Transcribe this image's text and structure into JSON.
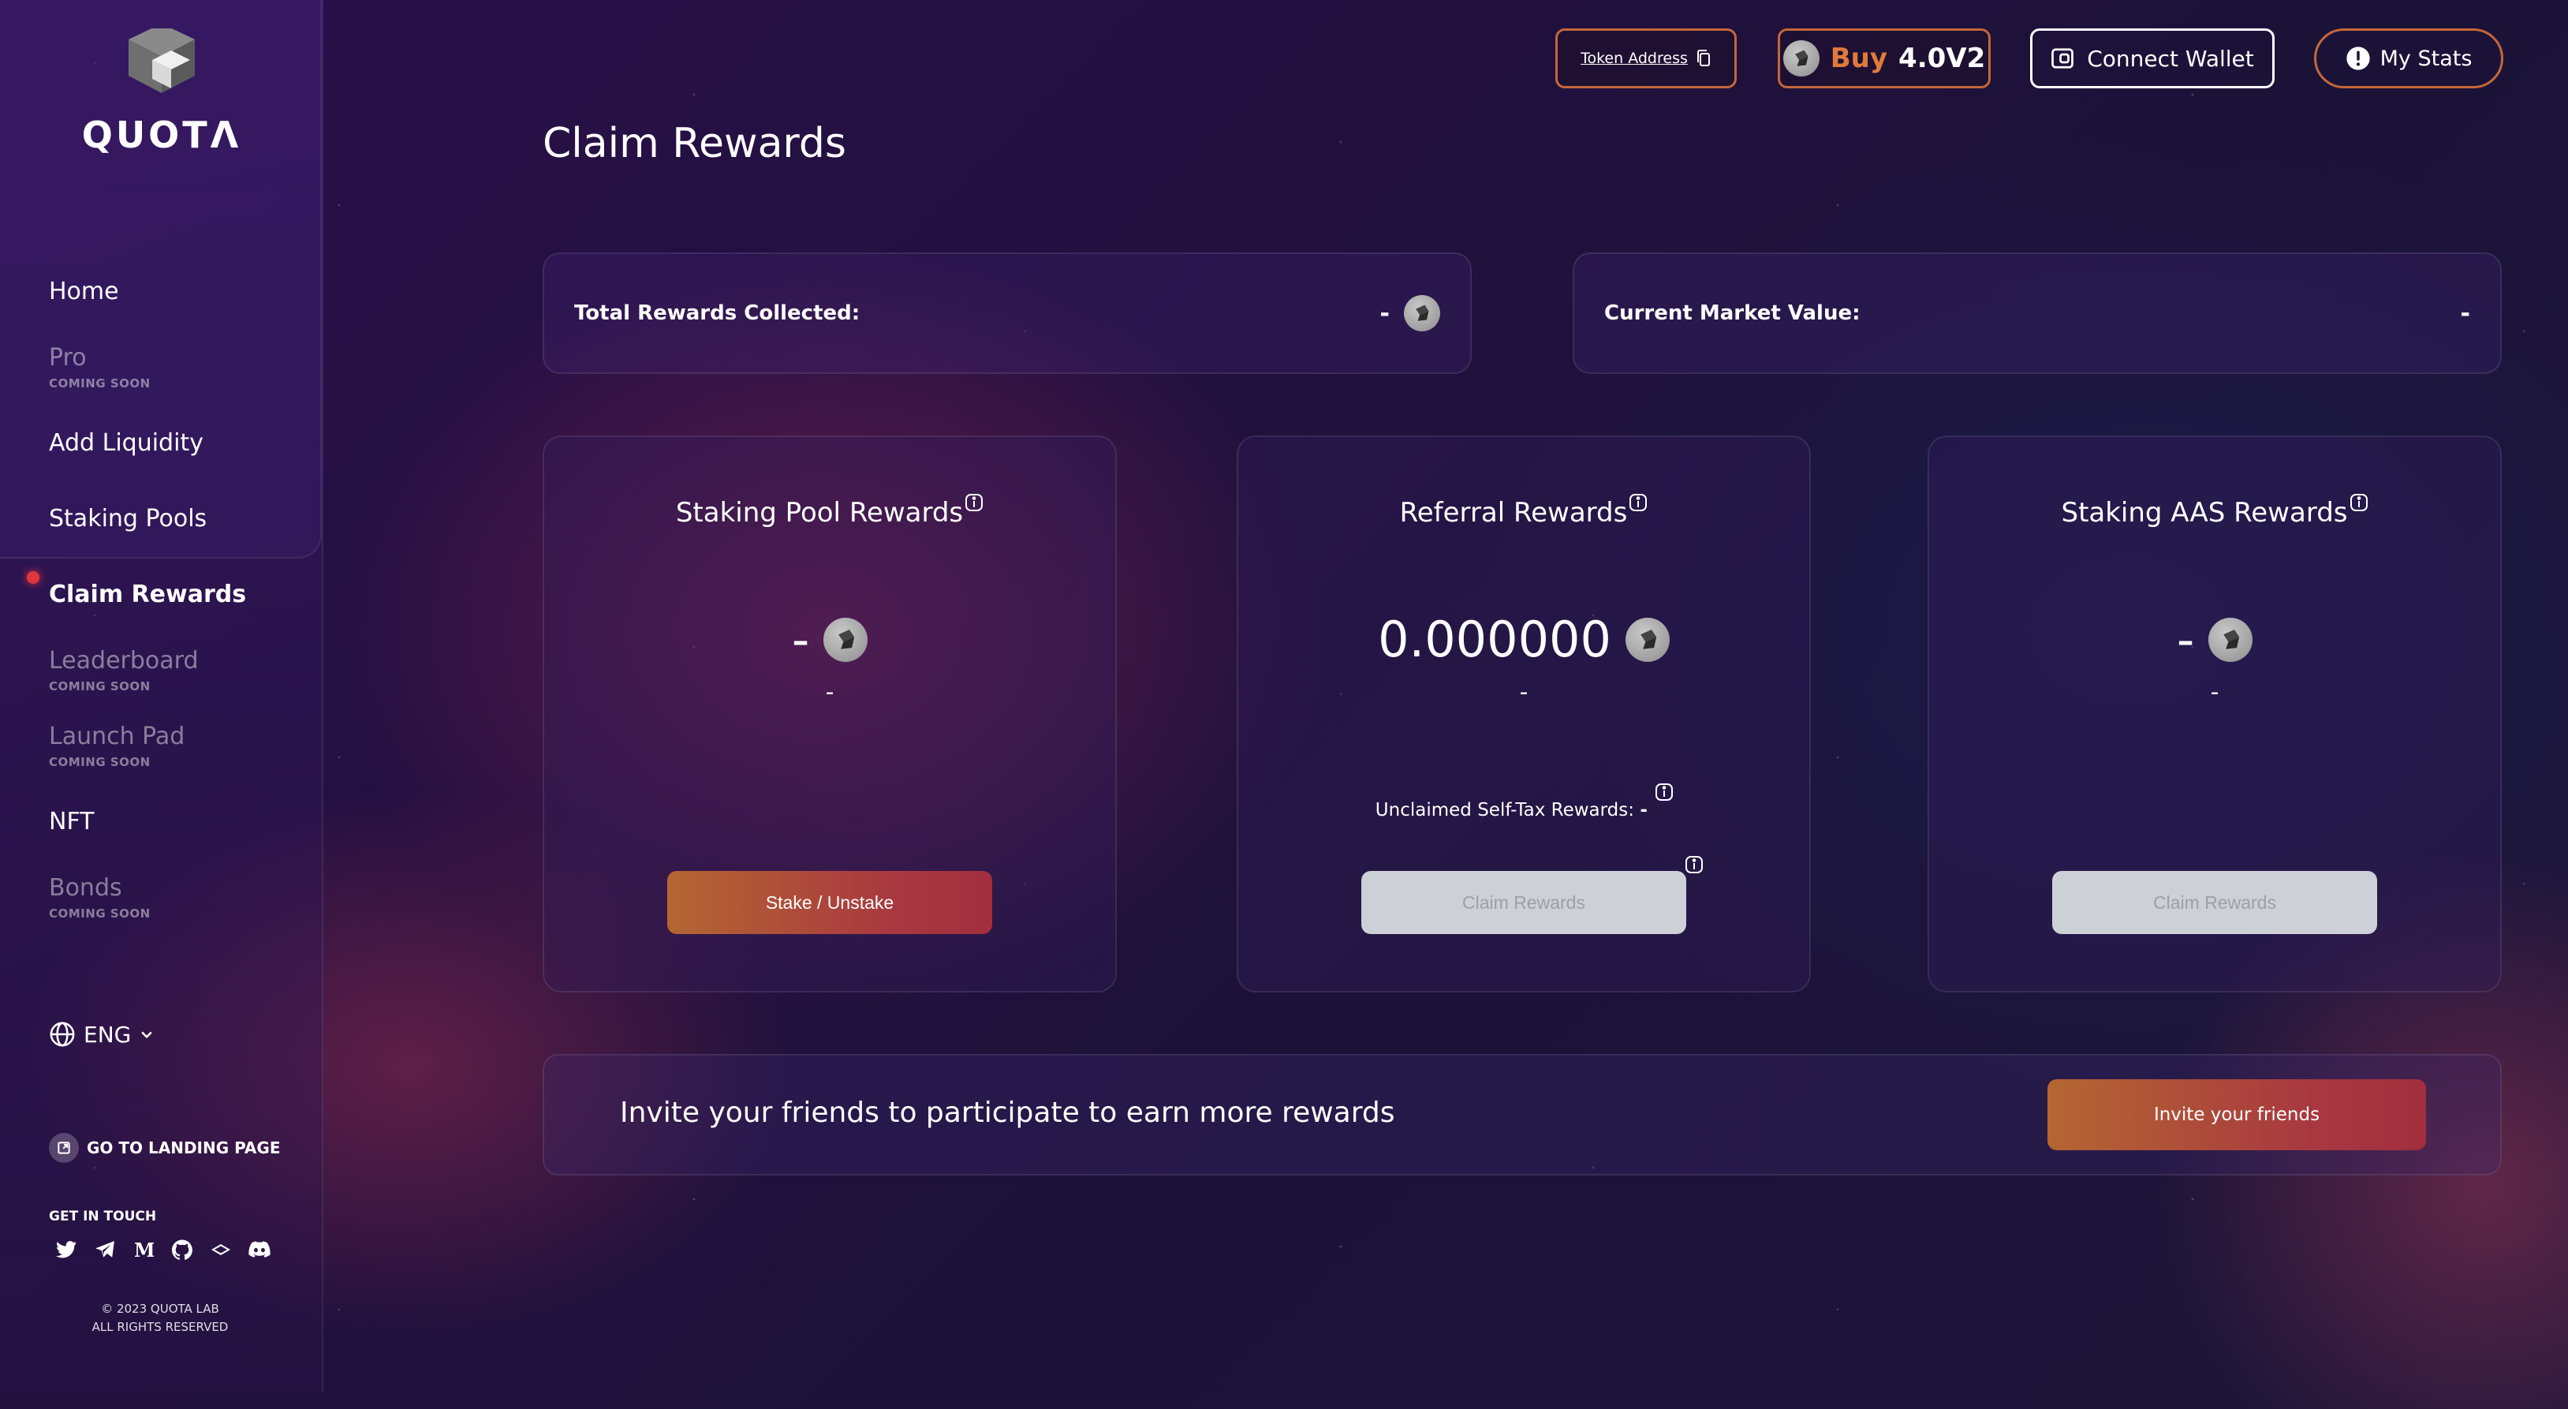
{
  "brand": {
    "name": "QUOTΛ"
  },
  "sidebar": {
    "items": [
      {
        "label": "Home",
        "soon": ""
      },
      {
        "label": "Pro",
        "soon": "COMING SOON"
      },
      {
        "label": "Add Liquidity",
        "soon": ""
      },
      {
        "label": "Staking Pools",
        "soon": ""
      },
      {
        "label": "Claim Rewards",
        "soon": ""
      },
      {
        "label": "Leaderboard",
        "soon": "COMING SOON"
      },
      {
        "label": "Launch Pad",
        "soon": "COMING SOON"
      },
      {
        "label": "NFT",
        "soon": ""
      },
      {
        "label": "Bonds",
        "soon": "COMING SOON"
      }
    ],
    "language": "ENG",
    "landing_label": "GO TO LANDING PAGE",
    "get_in_touch": "GET IN TOUCH",
    "socials": [
      "twitter-icon",
      "telegram-icon",
      "medium-icon",
      "github-icon",
      "gitbook-icon",
      "discord-icon"
    ],
    "copyright_line1": "© 2023 QUOTA LAB",
    "copyright_line2": "ALL RIGHTS RESERVED"
  },
  "topbar": {
    "token_address": "Token Address",
    "buy_word": "Buy",
    "buy_value": "4.0V2",
    "connect_wallet": "Connect Wallet",
    "my_stats": "My Stats"
  },
  "page": {
    "title": "Claim Rewards"
  },
  "summary": {
    "total_label": "Total Rewards Collected:",
    "total_value": "-",
    "market_label": "Current Market Value:",
    "market_value": "-"
  },
  "cards": {
    "staking_pool": {
      "title": "Staking Pool Rewards",
      "value": "-",
      "sub": "-",
      "button": "Stake / Unstake"
    },
    "referral": {
      "title": "Referral Rewards",
      "value": "0.000000",
      "sub": "-",
      "unclaimed_label": "Unclaimed Self-Tax Rewards:",
      "unclaimed_value": "-",
      "button": "Claim Rewards"
    },
    "staking_aas": {
      "title": "Staking AAS Rewards",
      "value": "-",
      "sub": "-",
      "button": "Claim Rewards"
    }
  },
  "invite": {
    "text": "Invite your friends to participate to earn more rewards",
    "button": "Invite your friends"
  },
  "colors": {
    "accent_orange": "#c4673a",
    "accent_red": "#a22e3e",
    "active_dot": "#e0353c"
  }
}
